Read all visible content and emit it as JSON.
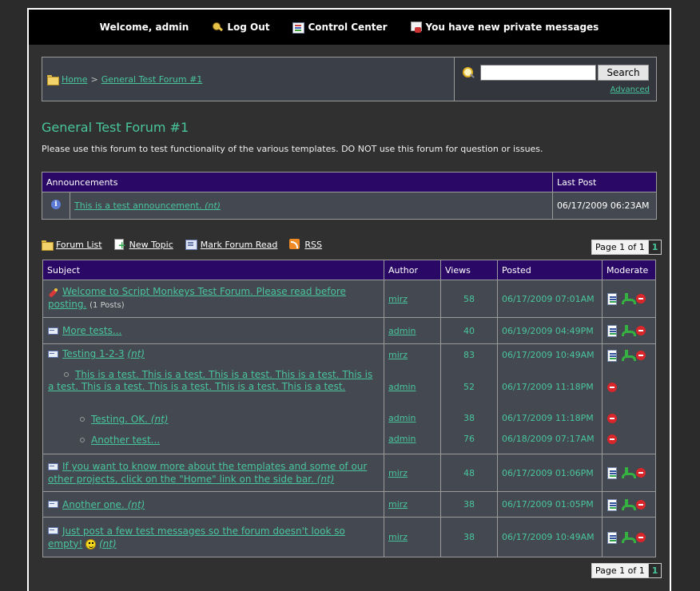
{
  "header": {
    "welcome": "Welcome, admin",
    "logout": "Log Out",
    "control_center": "Control Center",
    "private_messages": "You have new private messages"
  },
  "breadcrumb": {
    "home": "Home",
    "separator": ">",
    "forum": "General Test Forum #1"
  },
  "search": {
    "button": "Search",
    "advanced": "Advanced",
    "value": ""
  },
  "forum": {
    "title": "General Test Forum #1",
    "description": "Please use this forum to test functionality of the various templates. DO NOT use this forum for question or issues."
  },
  "announcements": {
    "header": "Announcements",
    "last_post_header": "Last Post",
    "items": [
      {
        "title": "This is a test announcement.",
        "tag": "(nt)",
        "last_post": "06/17/2009 06:23AM"
      }
    ]
  },
  "actions": {
    "forum_list": "Forum List",
    "new_topic": "New Topic",
    "mark_read": "Mark Forum Read",
    "rss": "RSS"
  },
  "pager": {
    "label": "Page 1 of 1",
    "current": "1"
  },
  "topics": {
    "headers": {
      "subject": "Subject",
      "author": "Author",
      "views": "Views",
      "posted": "Posted",
      "moderate": "Moderate"
    },
    "rows": [
      {
        "title": "Welcome to Script Monkeys Test Forum. Please read before posting.",
        "posts": "(1 Posts)",
        "author": "mirz",
        "views": "58",
        "posted": "06/17/2009 07:01AM"
      },
      {
        "title": "More tests...",
        "author": "admin",
        "views": "40",
        "posted": "06/19/2009 04:49PM"
      },
      {
        "title": "Testing 1-2-3",
        "tag": "(nt)",
        "author": "mirz",
        "views": "83",
        "posted": "06/17/2009 10:49AM",
        "replies": [
          {
            "title": "This is a test. This is a test. This is a test. This is a test. This is a test. This is a test. This is a test. This is a test. This is a test.",
            "author": "admin",
            "views": "52",
            "posted": "06/17/2009 11:18PM"
          },
          {
            "title": "Testing. OK.",
            "tag": "(nt)",
            "author": "admin",
            "views": "38",
            "posted": "06/17/2009 11:18PM"
          },
          {
            "title": "Another test...",
            "author": "admin",
            "views": "76",
            "posted": "06/18/2009 07:17AM"
          }
        ]
      },
      {
        "title": "If you want to know more about the templates and some of our other projects, click on the \"Home\" link on the side bar.",
        "tag": "(nt)",
        "author": "mirz",
        "views": "48",
        "posted": "06/17/2009 01:06PM"
      },
      {
        "title": "Another one.",
        "tag": "(nt)",
        "author": "mirz",
        "views": "38",
        "posted": "06/17/2009 01:05PM"
      },
      {
        "title": "Just post a few test messages so the forum doesn't look so empty!",
        "tag": "(nt)",
        "author": "mirz",
        "views": "38",
        "posted": "06/17/2009 10:49AM"
      }
    ]
  }
}
